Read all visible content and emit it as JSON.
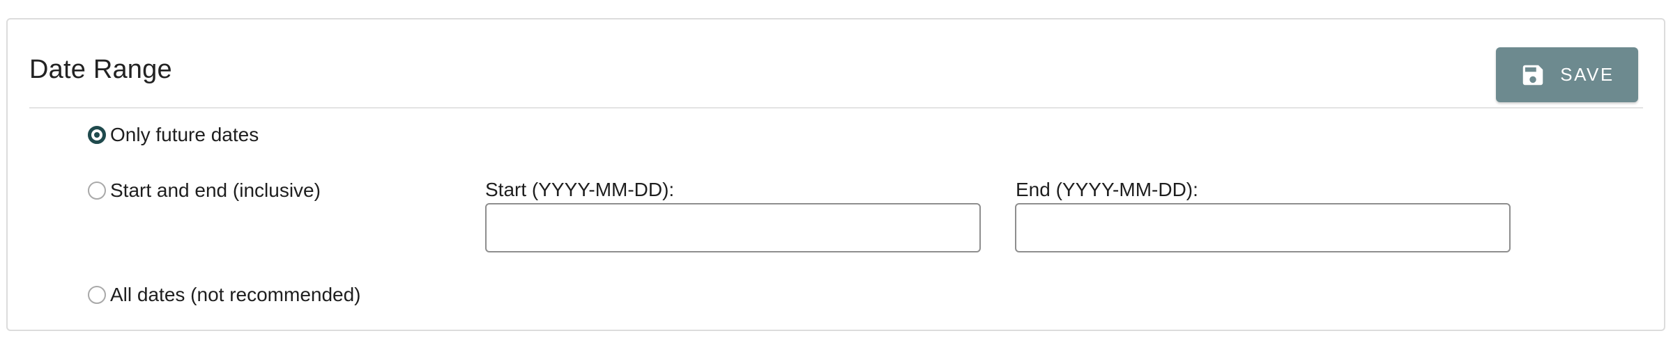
{
  "panel": {
    "title": "Date Range",
    "save_button": {
      "label": "SAVE",
      "icon": "floppy-disk-icon"
    }
  },
  "options": [
    {
      "id": "future",
      "label": "Only future dates",
      "checked": true
    },
    {
      "id": "range",
      "label": "Start and end (inclusive)",
      "checked": false
    },
    {
      "id": "all",
      "label": "All dates (not recommended)",
      "checked": false
    }
  ],
  "start_field": {
    "label": "Start (YYYY-MM-DD):",
    "value": ""
  },
  "end_field": {
    "label": "End (YYYY-MM-DD):",
    "value": ""
  },
  "colors": {
    "save_button_bg": "#6d8a8f",
    "radio_checked": "#1f4a4d"
  }
}
